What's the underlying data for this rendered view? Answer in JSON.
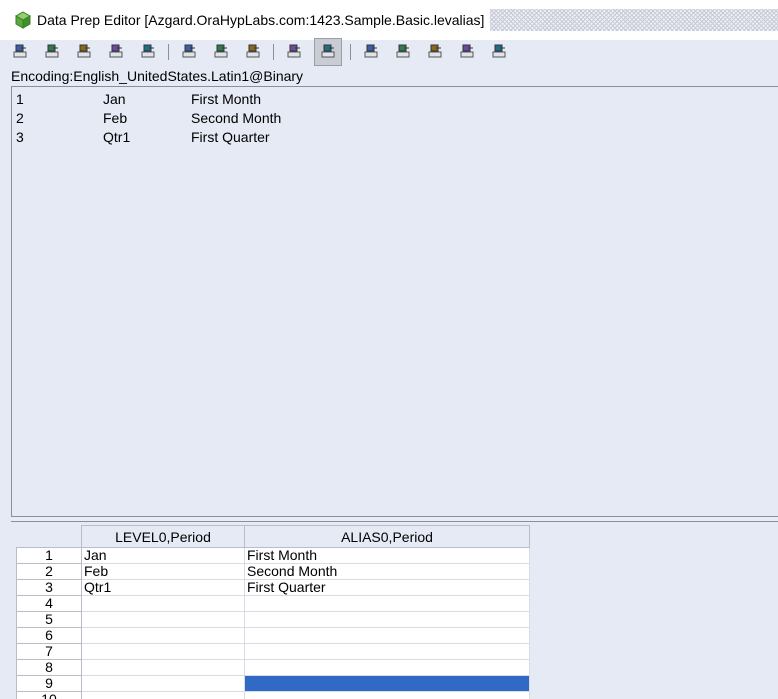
{
  "window": {
    "title": "Data Prep Editor [Azgard.OraHypLabs.com:1423.Sample.Basic.levalias]",
    "icon": "cube-icon"
  },
  "toolbar": {
    "buttons": [
      {
        "name": "toolbar-btn-1",
        "icon": "field-properties-icon"
      },
      {
        "name": "toolbar-btn-2",
        "icon": "dimension-build-icon"
      },
      {
        "name": "toolbar-btn-3",
        "icon": "move-field-icon"
      },
      {
        "name": "toolbar-btn-4",
        "icon": "join-field-icon"
      },
      {
        "name": "toolbar-btn-5",
        "icon": "create-field-text-icon"
      },
      {
        "name": "toolbar-btn-6",
        "icon": "select-record-icon"
      },
      {
        "name": "toolbar-btn-7",
        "icon": "reject-record-icon"
      },
      {
        "name": "toolbar-btn-8",
        "icon": "delete-record-icon"
      },
      {
        "name": "toolbar-btn-9",
        "icon": "data-load-fields-icon"
      },
      {
        "name": "toolbar-btn-10",
        "icon": "dimension-build-fields-icon",
        "active": true
      },
      {
        "name": "toolbar-btn-11",
        "icon": "dimension-build-settings-icon"
      },
      {
        "name": "toolbar-btn-12",
        "icon": "data-load-settings-icon"
      },
      {
        "name": "toolbar-btn-13",
        "icon": "associate-outline-icon"
      },
      {
        "name": "toolbar-btn-14",
        "icon": "data-source-properties-icon"
      },
      {
        "name": "toolbar-btn-15",
        "icon": "validate-icon"
      }
    ]
  },
  "encoding": "Encoding:English_UnitedStates.Latin1@Binary",
  "preview": {
    "rows": [
      [
        "1",
        "Jan",
        "First Month"
      ],
      [
        "2",
        "Feb",
        "Second Month"
      ],
      [
        "3",
        "Qtr1",
        "First Quarter"
      ]
    ]
  },
  "grid": {
    "columns": [
      "LEVEL0,Period",
      "ALIAS0,Period"
    ],
    "rows": [
      {
        "num": "1",
        "cells": [
          "Jan",
          "First Month"
        ]
      },
      {
        "num": "2",
        "cells": [
          "Feb",
          "Second Month"
        ]
      },
      {
        "num": "3",
        "cells": [
          "Qtr1",
          "First Quarter"
        ]
      },
      {
        "num": "4",
        "cells": [
          "",
          ""
        ]
      },
      {
        "num": "5",
        "cells": [
          "",
          ""
        ]
      },
      {
        "num": "6",
        "cells": [
          "",
          ""
        ]
      },
      {
        "num": "7",
        "cells": [
          "",
          ""
        ]
      },
      {
        "num": "8",
        "cells": [
          "",
          ""
        ]
      },
      {
        "num": "9",
        "cells": [
          "",
          ""
        ]
      },
      {
        "num": "10",
        "cells": [
          "",
          ""
        ]
      }
    ]
  },
  "colors": {
    "background": "#e5eaf5",
    "selection": "#316ac5"
  }
}
